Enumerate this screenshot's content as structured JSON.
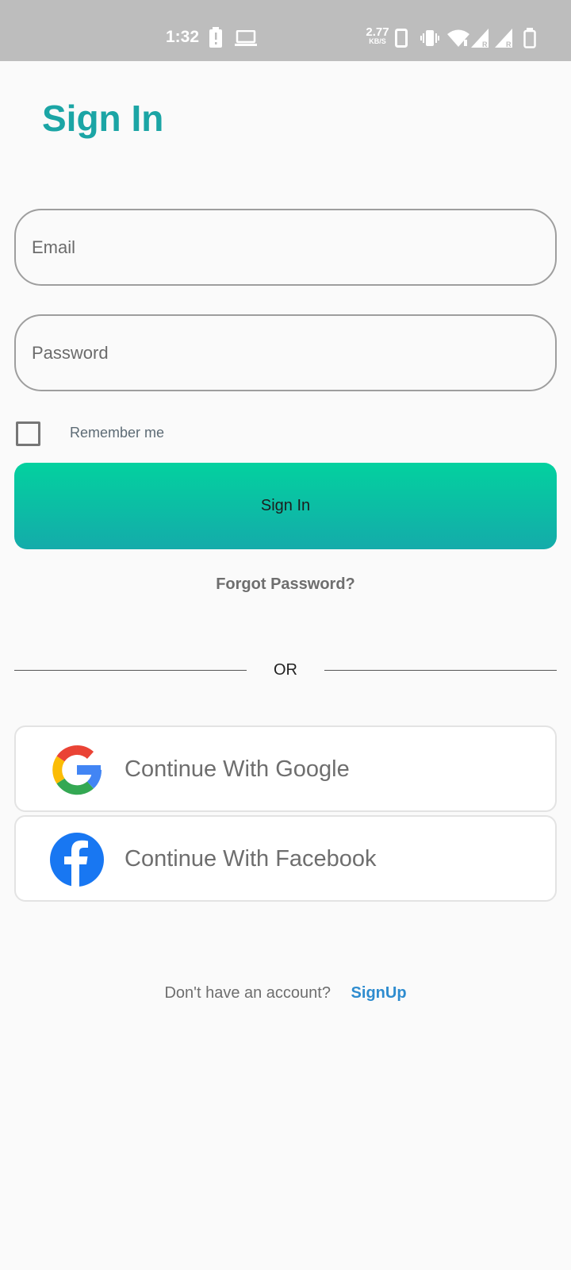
{
  "status_bar": {
    "time": "1:32",
    "net_speed": "2.77",
    "net_speed_unit": "KB/S"
  },
  "page": {
    "title": "Sign In"
  },
  "form": {
    "email_placeholder": "Email",
    "password_placeholder": "Password",
    "remember_label": "Remember me",
    "remember_checked": false,
    "signin_label": "Sign In",
    "forgot_label": "Forgot Password?"
  },
  "divider": {
    "label": "OR"
  },
  "social": {
    "google_label": "Continue With Google",
    "facebook_label": "Continue With Facebook"
  },
  "footer": {
    "prompt": "Don't have an account?",
    "signup_label": "SignUp"
  },
  "colors": {
    "title": "#1ba5a5",
    "button_gradient_top": "#03d19f",
    "button_gradient_bottom": "#14abaa",
    "link": "#2e8ccf",
    "facebook_blue": "#1877f2"
  }
}
